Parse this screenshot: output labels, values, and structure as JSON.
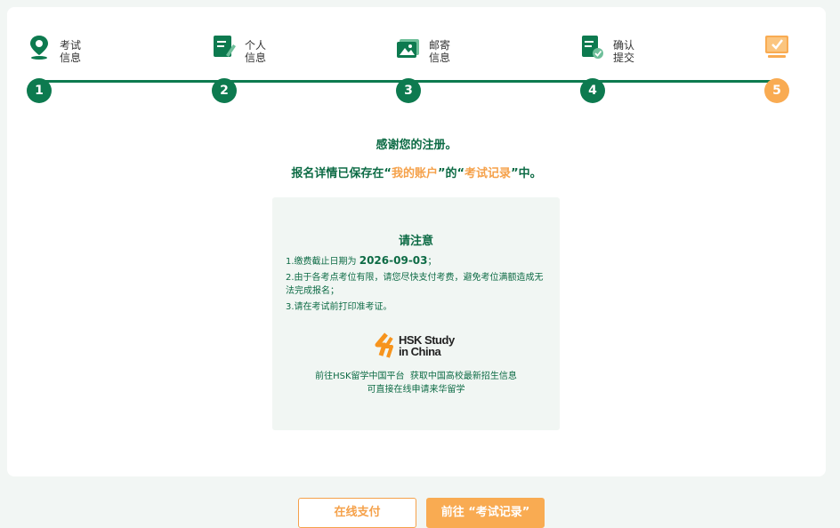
{
  "steps": [
    {
      "num": "1",
      "line1": "考试",
      "line2": "信息",
      "icon": "location-pin-icon"
    },
    {
      "num": "2",
      "line1": "个人",
      "line2": "信息",
      "icon": "edit-document-icon"
    },
    {
      "num": "3",
      "line1": "邮寄",
      "line2": "信息",
      "icon": "photo-mail-icon"
    },
    {
      "num": "4",
      "line1": "确认",
      "line2": "提交",
      "icon": "confirm-document-icon"
    },
    {
      "num": "5",
      "line1": "",
      "line2": "",
      "icon": "completed-monitor-icon"
    }
  ],
  "message": {
    "line1": "感谢您的注册。",
    "line2_pre": "报名详情已保存在“",
    "line2_account": "我的账户",
    "line2_mid": "”的“",
    "line2_record": "考试记录",
    "line2_post": "”中。"
  },
  "notice": {
    "title": "请注意",
    "item1_pre": "1.缴费截止日期为 ",
    "item1_date": "2026-09-03",
    "item1_post": "；",
    "item2": "2.由于各考点考位有限，请您尽快支付考费，避免考位满额造成无法完成报名；",
    "item3": "3.请在考试前打印准考证。",
    "logo_line1": "HSK Study",
    "logo_line2": "in China",
    "promo_line1": "前往HSK留学中国平台  获取中国高校最新招生信息",
    "promo_line2": "可直接在线申请来华留学"
  },
  "buttons": {
    "pay": "在线支付",
    "record": "前往 “考试记录”"
  },
  "colors": {
    "primary": "#0d7a4f",
    "accent": "#f9ab52"
  }
}
